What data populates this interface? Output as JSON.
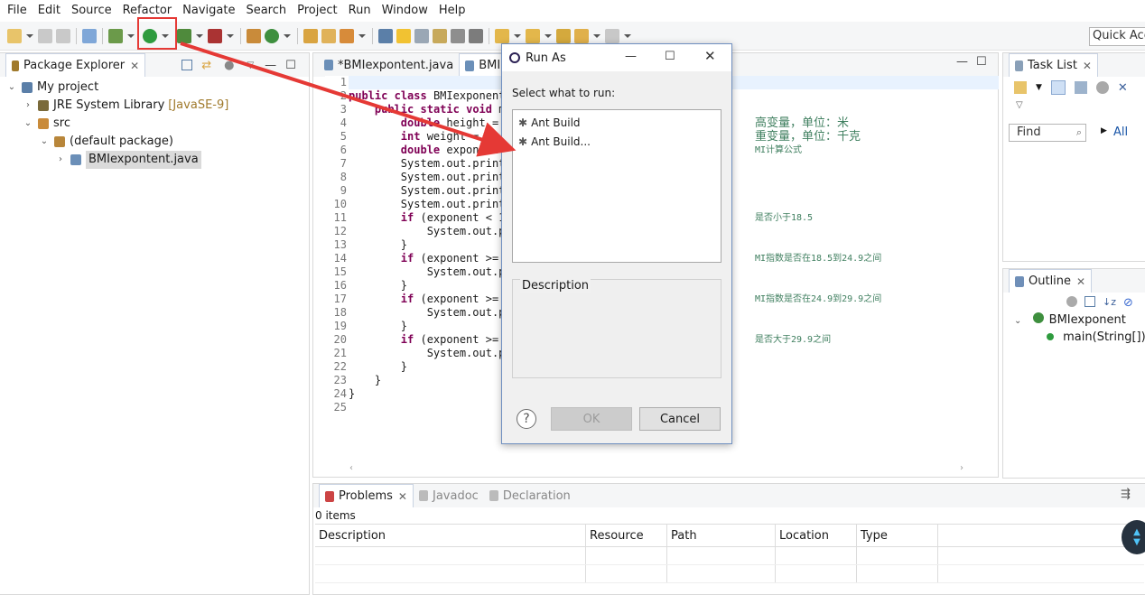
{
  "menu": [
    "File",
    "Edit",
    "Source",
    "Refactor",
    "Navigate",
    "Search",
    "Project",
    "Run",
    "Window",
    "Help"
  ],
  "quick_access": "Quick Access",
  "package_explorer": {
    "tab": "Package Explorer",
    "tree": [
      {
        "label": "My project",
        "level": 0,
        "expanded": true
      },
      {
        "label": "JRE System Library",
        "deco": "[JavaSE-9]",
        "level": 1,
        "expanded": false
      },
      {
        "label": "src",
        "level": 1,
        "expanded": true
      },
      {
        "label": "(default package)",
        "level": 2,
        "expanded": true
      },
      {
        "label": "BMIexpontent.java",
        "level": 3,
        "expanded": false,
        "selected": true
      }
    ]
  },
  "editor": {
    "tabs": [
      {
        "label": "*BMIexpontent.java",
        "active": false
      },
      {
        "label": "BMI",
        "active": true
      }
    ],
    "lines": [
      "",
      "public class BMIexponent",
      "    public static void m",
      "        double height = ",
      "        int weight = 70;",
      "        double exponent ",
      "        System.out.print",
      "        System.out.print",
      "        System.out.print",
      "        System.out.print",
      "        if (exponent < 1",
      "            System.out.p",
      "        }",
      "        if (exponent >= ",
      "            System.out.p",
      "        }",
      "        if (exponent >= ",
      "            System.out.p",
      "        }",
      "        if (exponent >= ",
      "            System.out.p",
      "        }",
      "    }",
      "}",
      ""
    ],
    "comments": [
      {
        "line": 4,
        "text": "高变量，单位：米"
      },
      {
        "line": 5,
        "text": "重变量，单位：千克"
      },
      {
        "line": 6,
        "text": "MI计算公式"
      },
      {
        "line": 11,
        "text": "是否小于18.5"
      },
      {
        "line": 14,
        "text": "MI指数是否在18.5到24.9之间"
      },
      {
        "line": 17,
        "text": "MI指数是否在24.9到29.9之间"
      },
      {
        "line": 20,
        "text": "是否大于29.9之间"
      }
    ]
  },
  "dialog": {
    "title": "Run As",
    "prompt": "Select what to run:",
    "options": [
      "Ant Build",
      "Ant Build..."
    ],
    "description_label": "Description",
    "ok_label": "OK",
    "cancel_label": "Cancel",
    "help_label": "?"
  },
  "task_list": {
    "tab": "Task List",
    "find_placeholder": "Find",
    "all_label": "All"
  },
  "outline": {
    "tab": "Outline",
    "class_name": "BMIexponent",
    "method": "main(String[]) :"
  },
  "problems": {
    "tabs": [
      "Problems",
      "Javadoc",
      "Declaration"
    ],
    "count": "0 items",
    "columns": [
      "Description",
      "Resource",
      "Path",
      "Location",
      "Type"
    ]
  },
  "colors": {
    "keyword": "#7f0055",
    "comment": "#3f7f5f",
    "highlight": "#e53935",
    "selection": "#dadada"
  }
}
